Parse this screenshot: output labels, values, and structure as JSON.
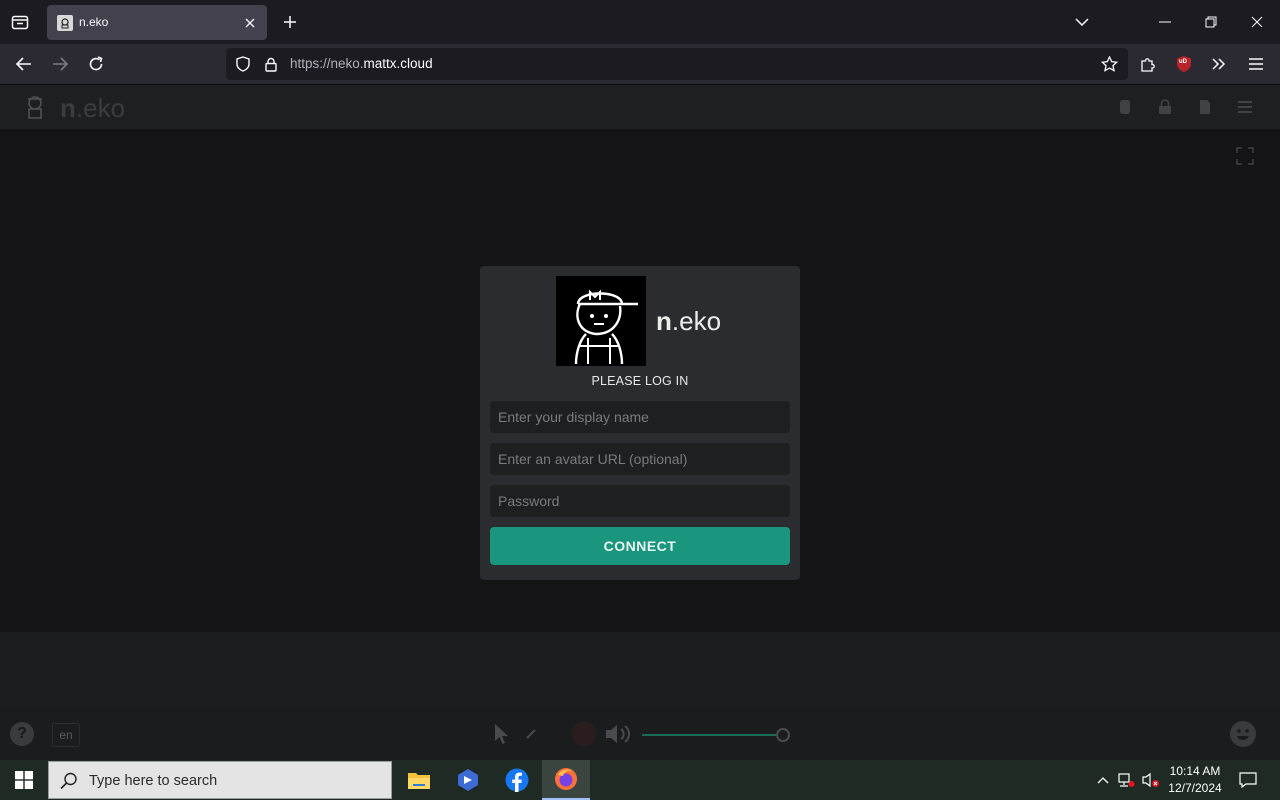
{
  "browser": {
    "tab_title": "n.eko",
    "url_prefix": "https://neko.",
    "url_domain": "mattx.cloud",
    "ublock_badge": "uD"
  },
  "app": {
    "logo_bold": "n",
    "logo_rest": ".eko",
    "language": "en",
    "help_glyph": "?",
    "volume_percent": 100
  },
  "login": {
    "brand_bold": "n",
    "brand_rest": ".eko",
    "heading": "PLEASE LOG IN",
    "display_name_placeholder": "Enter your display name",
    "avatar_placeholder": "Enter an avatar URL (optional)",
    "password_placeholder": "Password",
    "connect_label": "CONNECT"
  },
  "taskbar": {
    "search_placeholder": "Type here to search",
    "time": "10:14 AM",
    "date": "12/7/2024"
  },
  "colors": {
    "accent": "#19967d",
    "dialog_bg": "#2a2c2f",
    "field_bg": "#1e1f21"
  }
}
